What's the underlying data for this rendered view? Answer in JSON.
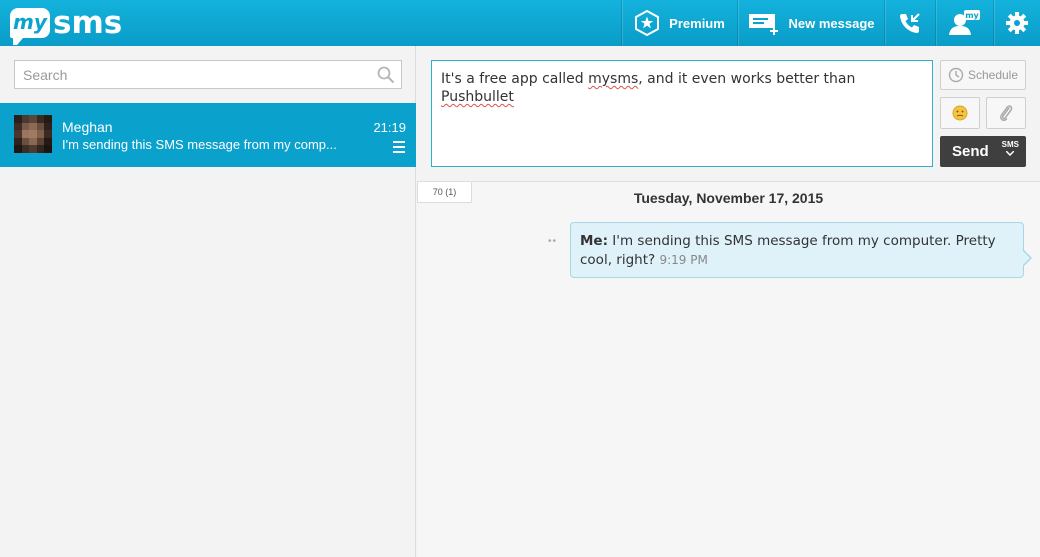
{
  "app": {
    "logo_my": "my",
    "logo_sms": "sms"
  },
  "topnav": {
    "premium_label": "Premium",
    "new_message_label": "New message",
    "account_badge": "my"
  },
  "sidebar": {
    "search_placeholder": "Search",
    "conversations": [
      {
        "name": "Meghan",
        "time": "21:19",
        "preview": "I'm sending this SMS message from my computer. Pretty cool, right?",
        "preview_shown": "I'm sending this SMS message from my comp..."
      }
    ]
  },
  "composer": {
    "text_part1": "It's a free app called ",
    "text_misspelled_1": "mysms",
    "text_part2": ", and it even works better than ",
    "text_misspelled_2": "Pushbullet",
    "schedule_label": "Schedule",
    "send_label": "Send",
    "send_type": "SMS",
    "char_count": "70 (1)"
  },
  "thread": {
    "date_header": "Tuesday, November 17, 2015",
    "messages": [
      {
        "sender": "Me:",
        "text": "I'm sending this SMS message from my computer. Pretty cool, right?",
        "time": "9:19 PM",
        "status": "••"
      }
    ]
  },
  "colors": {
    "brand": "#0aa3d0",
    "selected_row": "#0aa1cd",
    "send_button": "#3f3f3f",
    "bubble_bg": "#dff1f9"
  },
  "icons": [
    "star-hexagon-icon",
    "new-message-icon",
    "call-icon",
    "account-icon",
    "gear-icon",
    "search-icon",
    "clock-icon",
    "emoji-icon",
    "paperclip-icon",
    "chevron-down-icon",
    "hamburger-icon"
  ]
}
